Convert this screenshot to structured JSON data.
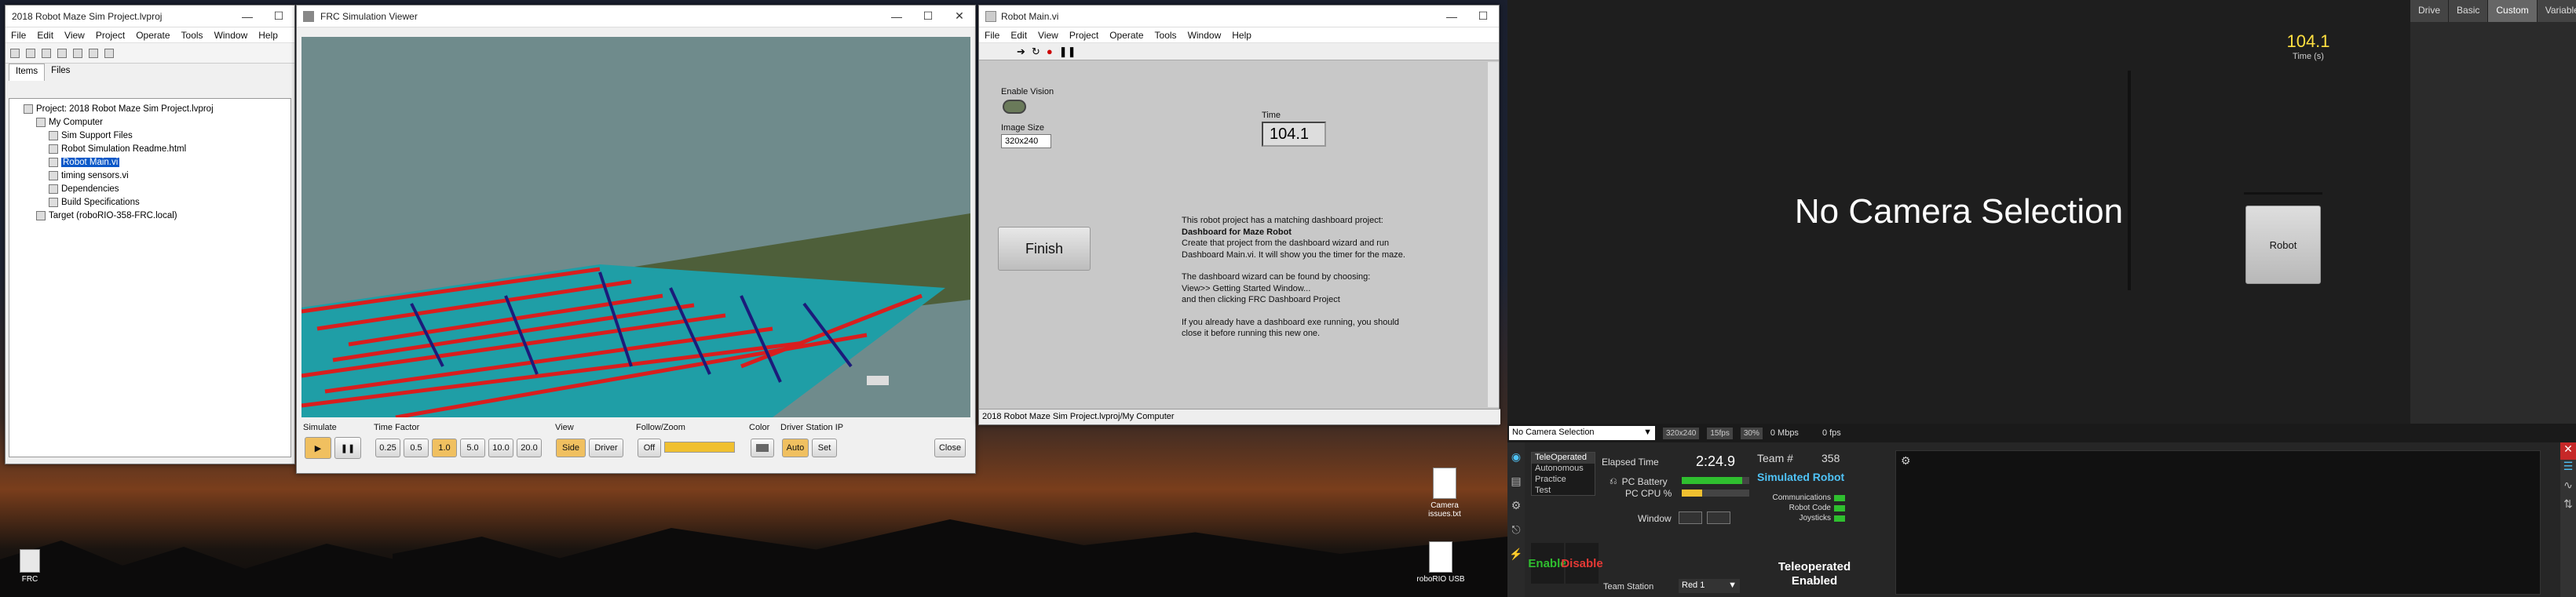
{
  "lv_project": {
    "title": "2018 Robot Maze Sim Project.lvproj",
    "menu": [
      "File",
      "Edit",
      "View",
      "Project",
      "Operate",
      "Tools",
      "Window",
      "Help"
    ],
    "tabs": [
      "Items",
      "Files"
    ],
    "tree": [
      {
        "label": "Project: 2018 Robot Maze Sim Project.lvproj",
        "indent": 0
      },
      {
        "label": "My Computer",
        "indent": 1
      },
      {
        "label": "Sim Support Files",
        "indent": 2
      },
      {
        "label": "Robot Simulation Readme.html",
        "indent": 2
      },
      {
        "label": "Robot Main.vi",
        "indent": 2,
        "selected": true
      },
      {
        "label": "timing sensors.vi",
        "indent": 2
      },
      {
        "label": "Dependencies",
        "indent": 2
      },
      {
        "label": "Build Specifications",
        "indent": 2
      },
      {
        "label": "Target (roboRIO-358-FRC.local)",
        "indent": 1
      }
    ]
  },
  "sim_viewer": {
    "title": "FRC Simulation Viewer",
    "simulate_label": "Simulate",
    "time_factor_label": "Time Factor",
    "time_factors": [
      "0.25",
      "0.5",
      "1.0",
      "5.0",
      "10.0",
      "20.0"
    ],
    "time_factor_selected": "1.0",
    "view_label": "View",
    "view_options": [
      "Side",
      "Driver"
    ],
    "view_selected": "Side",
    "follow_label": "Follow/Zoom",
    "follow_value": "Off",
    "color_label": "Color",
    "ds_ip_label": "Driver Station IP",
    "ds_ip_auto": "Auto",
    "ds_ip_set": "Set",
    "close_label": "Close"
  },
  "robot_main": {
    "title": "Robot Main.vi",
    "menu": [
      "File",
      "Edit",
      "View",
      "Project",
      "Operate",
      "Tools",
      "Window",
      "Help"
    ],
    "enable_vision_label": "Enable Vision",
    "image_size_label": "Image Size",
    "image_size_value": "320x240",
    "time_label": "Time",
    "time_value": "104.1",
    "finish_label": "Finish",
    "info_lines": [
      "This robot project has a matching dashboard project:",
      "Dashboard for Maze Robot",
      "Create that project from the dashboard wizard and run",
      "Dashboard Main.vi. It will show you the timer for the maze.",
      "",
      "The dashboard wizard can be found by choosing:",
      "View>> Getting Started Window...",
      "and then clicking FRC Dashboard Project",
      "",
      "If you already have a dashboard exe running, you should",
      "close it before running this new one."
    ],
    "status_path": "2018 Robot Maze Sim Project.lvproj/My Computer"
  },
  "desktop_icons": [
    {
      "label": "FRC"
    },
    {
      "label": "Camera issues.txt"
    },
    {
      "label": "roboRIO USB"
    }
  ],
  "dashboard": {
    "camera_text": "No Camera Selection",
    "tabs": [
      "Drive",
      "Basic",
      "Custom",
      "Variables"
    ],
    "active_tab": "Custom",
    "time_value": "104.1",
    "time_label": "Time (s)",
    "robot_button": "Robot",
    "camera_select": "No Camera Selection",
    "res_badges": [
      "320x240",
      "15fps",
      "30%"
    ],
    "mbps": "0 Mbps",
    "fps": "0 fps"
  },
  "driver_station": {
    "modes": [
      "TeleOperated",
      "Autonomous",
      "Practice",
      "Test"
    ],
    "selected_mode": "TeleOperated",
    "enable_label": "Enable",
    "disable_label": "Disable",
    "elapsed_label": "Elapsed Time",
    "elapsed_value": "2:24.9",
    "pc_battery_label": "PC Battery",
    "pc_battery_level": 0.9,
    "pc_cpu_label": "PC CPU %",
    "pc_cpu_level": 0.3,
    "window_label": "Window",
    "team_station_label": "Team Station",
    "team_station_value": "Red 1",
    "team_label": "Team #",
    "team_number": "358",
    "robot_name": "Simulated Robot",
    "indicators": [
      "Communications",
      "Robot Code",
      "Joysticks"
    ],
    "status": "Teleoperated Enabled",
    "colors": {
      "accent": "#4fc3f7",
      "green": "#2fbf2f",
      "red": "#e53935",
      "yellow": "#f0c030"
    }
  }
}
